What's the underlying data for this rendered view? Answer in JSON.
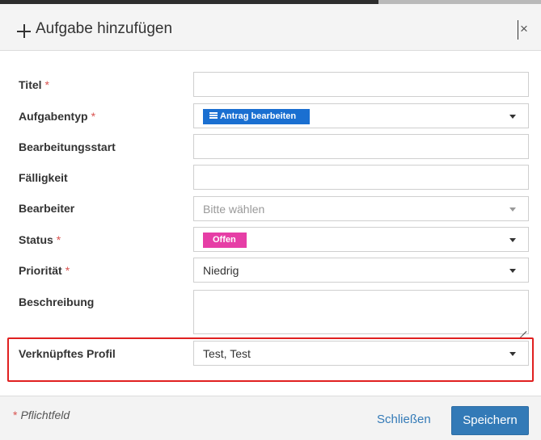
{
  "header": {
    "title": "Aufgabe hinzufügen",
    "close_glyph": "×"
  },
  "form": {
    "required_mark": "*",
    "fields": {
      "titel": {
        "label": "Titel",
        "required": true,
        "value": ""
      },
      "aufgabentyp": {
        "label": "Aufgabentyp",
        "required": true,
        "badge": "Antrag bearbeiten",
        "badge_color": "#1a6fd1",
        "badge_icon": "list-icon"
      },
      "bearbeitungsstart": {
        "label": "Bearbeitungsstart",
        "required": false,
        "value": ""
      },
      "faelligkeit": {
        "label": "Fälligkeit",
        "required": false,
        "value": ""
      },
      "bearbeiter": {
        "label": "Bearbeiter",
        "required": false,
        "placeholder": "Bitte wählen",
        "disabled": true
      },
      "status": {
        "label": "Status",
        "required": true,
        "badge": "Offen",
        "badge_color": "#e63ea6"
      },
      "prioritaet": {
        "label": "Priorität",
        "required": true,
        "value": "Niedrig"
      },
      "beschreibung": {
        "label": "Beschreibung",
        "required": false,
        "value": ""
      },
      "profil": {
        "label": "Verknüpftes Profil",
        "required": false,
        "value": "Test, Test",
        "highlighted": true,
        "highlight_color": "#e02020"
      }
    }
  },
  "footer": {
    "required_note_star": "*",
    "required_note": "Pflichtfeld",
    "close_label": "Schließen",
    "save_label": "Speichern",
    "primary_color": "#337ab7"
  }
}
